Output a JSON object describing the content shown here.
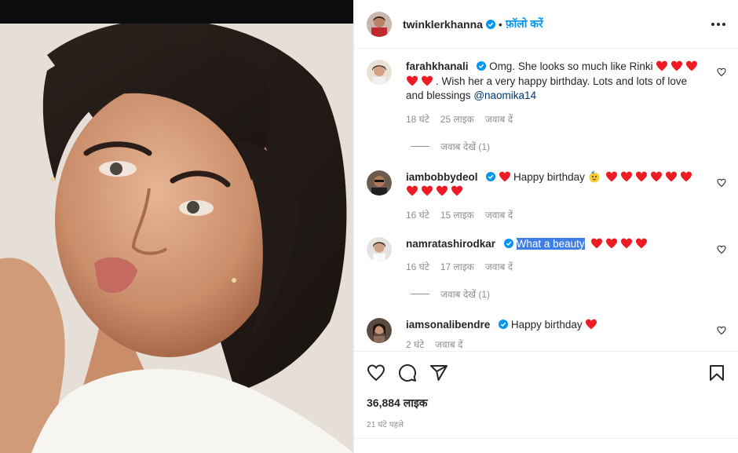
{
  "post": {
    "author": "twinklerkhanna",
    "follow_label": "फ़ॉलो करें",
    "separator": "•"
  },
  "comments": [
    {
      "username": "farahkhanali",
      "text_before": "Omg. She looks so much like Rinki",
      "hearts_inline": 5,
      "text_after": "Wish her a very happy birthday. Lots and lots of love and blessings",
      "mention": "@naomika14",
      "time": "18 घंटे",
      "likes": "25 लाइक",
      "reply": "जवाब दें",
      "view_replies": "जवाब देखें (1)"
    },
    {
      "username": "iambobbydeol",
      "text": "Happy birthday",
      "hearts": 10,
      "time": "16 घंटे",
      "likes": "15 लाइक",
      "reply": "जवाब दें"
    },
    {
      "username": "namratashirodkar",
      "text": "What a beauty",
      "hearts": 4,
      "time": "16 घंटे",
      "likes": "17 लाइक",
      "reply": "जवाब दें",
      "view_replies": "जवाब देखें (1)"
    },
    {
      "username": "iamsonalibendre",
      "text": "Happy birthday",
      "hearts": 1,
      "time": "2 घंटे",
      "reply": "जवाब दें"
    }
  ],
  "footer": {
    "likes": "36,884 लाइक",
    "posted": "21 घंटे पहले"
  },
  "icons": {
    "like": "heart-outline-icon",
    "comment": "speech-bubble-icon",
    "share": "paper-plane-icon",
    "save": "bookmark-icon",
    "verified": "blue-check-icon"
  },
  "colors": {
    "accent": "#0095f6",
    "heart": "#ed1c24",
    "secondary_text": "#8e8e8e",
    "selection": "#3e7ee6"
  }
}
